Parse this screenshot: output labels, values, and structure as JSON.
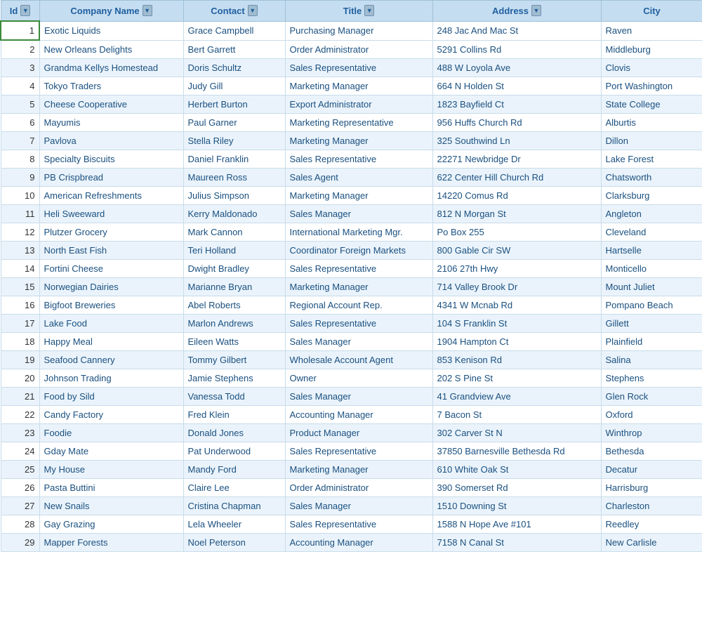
{
  "table": {
    "columns": [
      {
        "key": "id",
        "label": "Id"
      },
      {
        "key": "company",
        "label": "Company Name"
      },
      {
        "key": "contact",
        "label": "Contact"
      },
      {
        "key": "title",
        "label": "Title"
      },
      {
        "key": "address",
        "label": "Address"
      },
      {
        "key": "city",
        "label": "City"
      }
    ],
    "rows": [
      {
        "id": 1,
        "company": "Exotic Liquids",
        "contact": "Grace Campbell",
        "title": "Purchasing Manager",
        "address": "248 Jac And Mac St",
        "city": "Raven"
      },
      {
        "id": 2,
        "company": "New Orleans Delights",
        "contact": "Bert Garrett",
        "title": "Order Administrator",
        "address": "5291 Collins Rd",
        "city": "Middleburg"
      },
      {
        "id": 3,
        "company": "Grandma Kellys Homestead",
        "contact": "Doris Schultz",
        "title": "Sales Representative",
        "address": "488 W Loyola Ave",
        "city": "Clovis"
      },
      {
        "id": 4,
        "company": "Tokyo Traders",
        "contact": "Judy Gill",
        "title": "Marketing Manager",
        "address": "664 N Holden St",
        "city": "Port Washington"
      },
      {
        "id": 5,
        "company": "Cheese Cooperative",
        "contact": "Herbert Burton",
        "title": "Export Administrator",
        "address": "1823 Bayfield Ct",
        "city": "State College"
      },
      {
        "id": 6,
        "company": "Mayumis",
        "contact": "Paul Garner",
        "title": "Marketing Representative",
        "address": "956 Huffs Church Rd",
        "city": "Alburtis"
      },
      {
        "id": 7,
        "company": "Pavlova",
        "contact": "Stella Riley",
        "title": "Marketing Manager",
        "address": "325 Southwind Ln",
        "city": "Dillon"
      },
      {
        "id": 8,
        "company": "Specialty Biscuits",
        "contact": "Daniel Franklin",
        "title": "Sales Representative",
        "address": "22271 Newbridge Dr",
        "city": "Lake Forest"
      },
      {
        "id": 9,
        "company": "PB Crispbread",
        "contact": "Maureen Ross",
        "title": "Sales Agent",
        "address": "622 Center Hill Church Rd",
        "city": "Chatsworth"
      },
      {
        "id": 10,
        "company": "American Refreshments",
        "contact": "Julius Simpson",
        "title": "Marketing Manager",
        "address": "14220 Comus Rd",
        "city": "Clarksburg"
      },
      {
        "id": 11,
        "company": "Heli Sweeward",
        "contact": "Kerry Maldonado",
        "title": "Sales Manager",
        "address": "812 N Morgan St",
        "city": "Angleton"
      },
      {
        "id": 12,
        "company": "Plutzer Grocery",
        "contact": "Mark Cannon",
        "title": "International Marketing Mgr.",
        "address": "Po Box 255",
        "city": "Cleveland"
      },
      {
        "id": 13,
        "company": "North East Fish",
        "contact": "Teri Holland",
        "title": "Coordinator Foreign Markets",
        "address": "800 Gable Cir SW",
        "city": "Hartselle"
      },
      {
        "id": 14,
        "company": "Fortini Cheese",
        "contact": "Dwight Bradley",
        "title": "Sales Representative",
        "address": "2106 27th Hwy",
        "city": "Monticello"
      },
      {
        "id": 15,
        "company": "Norwegian Dairies",
        "contact": "Marianne Bryan",
        "title": "Marketing Manager",
        "address": "714 Valley Brook Dr",
        "city": "Mount Juliet"
      },
      {
        "id": 16,
        "company": "Bigfoot Breweries",
        "contact": "Abel Roberts",
        "title": "Regional Account Rep.",
        "address": "4341 W Mcnab Rd",
        "city": "Pompano Beach"
      },
      {
        "id": 17,
        "company": "Lake Food",
        "contact": "Marlon Andrews",
        "title": "Sales Representative",
        "address": "104 S Franklin St",
        "city": "Gillett"
      },
      {
        "id": 18,
        "company": "Happy Meal",
        "contact": "Eileen Watts",
        "title": "Sales Manager",
        "address": "1904 Hampton Ct",
        "city": "Plainfield"
      },
      {
        "id": 19,
        "company": "Seafood Cannery",
        "contact": "Tommy Gilbert",
        "title": "Wholesale Account Agent",
        "address": "853 Kenison Rd",
        "city": "Salina"
      },
      {
        "id": 20,
        "company": "Johnson Trading",
        "contact": "Jamie Stephens",
        "title": "Owner",
        "address": "202 S Pine St",
        "city": "Stephens"
      },
      {
        "id": 21,
        "company": "Food by Sild",
        "contact": "Vanessa Todd",
        "title": "Sales Manager",
        "address": "41 Grandview Ave",
        "city": "Glen Rock"
      },
      {
        "id": 22,
        "company": "Candy Factory",
        "contact": "Fred Klein",
        "title": "Accounting Manager",
        "address": "7 Bacon St",
        "city": "Oxford"
      },
      {
        "id": 23,
        "company": "Foodie",
        "contact": "Donald Jones",
        "title": "Product Manager",
        "address": "302 Carver St N",
        "city": "Winthrop"
      },
      {
        "id": 24,
        "company": "Gday Mate",
        "contact": "Pat Underwood",
        "title": "Sales Representative",
        "address": "37850 Barnesville Bethesda Rd",
        "city": "Bethesda"
      },
      {
        "id": 25,
        "company": "My House",
        "contact": "Mandy Ford",
        "title": "Marketing Manager",
        "address": "610 White Oak St",
        "city": "Decatur"
      },
      {
        "id": 26,
        "company": "Pasta Buttini",
        "contact": "Claire Lee",
        "title": "Order Administrator",
        "address": "390 Somerset Rd",
        "city": "Harrisburg"
      },
      {
        "id": 27,
        "company": "New Snails",
        "contact": "Cristina Chapman",
        "title": "Sales Manager",
        "address": "1510 Downing St",
        "city": "Charleston"
      },
      {
        "id": 28,
        "company": "Gay Grazing",
        "contact": "Lela Wheeler",
        "title": "Sales Representative",
        "address": "1588 N Hope Ave #101",
        "city": "Reedley"
      },
      {
        "id": 29,
        "company": "Mapper Forests",
        "contact": "Noel Peterson",
        "title": "Accounting Manager",
        "address": "7158 N Canal St",
        "city": "New Carlisle"
      }
    ]
  }
}
